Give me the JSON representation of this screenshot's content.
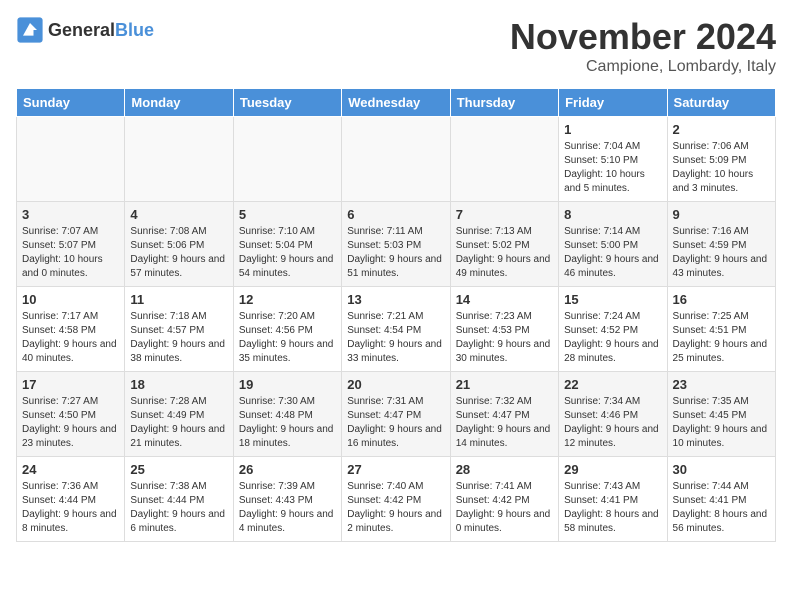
{
  "logo": {
    "general": "General",
    "blue": "Blue"
  },
  "title": "November 2024",
  "location": "Campione, Lombardy, Italy",
  "weekdays": [
    "Sunday",
    "Monday",
    "Tuesday",
    "Wednesday",
    "Thursday",
    "Friday",
    "Saturday"
  ],
  "weeks": [
    [
      {
        "day": "",
        "info": ""
      },
      {
        "day": "",
        "info": ""
      },
      {
        "day": "",
        "info": ""
      },
      {
        "day": "",
        "info": ""
      },
      {
        "day": "",
        "info": ""
      },
      {
        "day": "1",
        "info": "Sunrise: 7:04 AM\nSunset: 5:10 PM\nDaylight: 10 hours and 5 minutes."
      },
      {
        "day": "2",
        "info": "Sunrise: 7:06 AM\nSunset: 5:09 PM\nDaylight: 10 hours and 3 minutes."
      }
    ],
    [
      {
        "day": "3",
        "info": "Sunrise: 7:07 AM\nSunset: 5:07 PM\nDaylight: 10 hours and 0 minutes."
      },
      {
        "day": "4",
        "info": "Sunrise: 7:08 AM\nSunset: 5:06 PM\nDaylight: 9 hours and 57 minutes."
      },
      {
        "day": "5",
        "info": "Sunrise: 7:10 AM\nSunset: 5:04 PM\nDaylight: 9 hours and 54 minutes."
      },
      {
        "day": "6",
        "info": "Sunrise: 7:11 AM\nSunset: 5:03 PM\nDaylight: 9 hours and 51 minutes."
      },
      {
        "day": "7",
        "info": "Sunrise: 7:13 AM\nSunset: 5:02 PM\nDaylight: 9 hours and 49 minutes."
      },
      {
        "day": "8",
        "info": "Sunrise: 7:14 AM\nSunset: 5:00 PM\nDaylight: 9 hours and 46 minutes."
      },
      {
        "day": "9",
        "info": "Sunrise: 7:16 AM\nSunset: 4:59 PM\nDaylight: 9 hours and 43 minutes."
      }
    ],
    [
      {
        "day": "10",
        "info": "Sunrise: 7:17 AM\nSunset: 4:58 PM\nDaylight: 9 hours and 40 minutes."
      },
      {
        "day": "11",
        "info": "Sunrise: 7:18 AM\nSunset: 4:57 PM\nDaylight: 9 hours and 38 minutes."
      },
      {
        "day": "12",
        "info": "Sunrise: 7:20 AM\nSunset: 4:56 PM\nDaylight: 9 hours and 35 minutes."
      },
      {
        "day": "13",
        "info": "Sunrise: 7:21 AM\nSunset: 4:54 PM\nDaylight: 9 hours and 33 minutes."
      },
      {
        "day": "14",
        "info": "Sunrise: 7:23 AM\nSunset: 4:53 PM\nDaylight: 9 hours and 30 minutes."
      },
      {
        "day": "15",
        "info": "Sunrise: 7:24 AM\nSunset: 4:52 PM\nDaylight: 9 hours and 28 minutes."
      },
      {
        "day": "16",
        "info": "Sunrise: 7:25 AM\nSunset: 4:51 PM\nDaylight: 9 hours and 25 minutes."
      }
    ],
    [
      {
        "day": "17",
        "info": "Sunrise: 7:27 AM\nSunset: 4:50 PM\nDaylight: 9 hours and 23 minutes."
      },
      {
        "day": "18",
        "info": "Sunrise: 7:28 AM\nSunset: 4:49 PM\nDaylight: 9 hours and 21 minutes."
      },
      {
        "day": "19",
        "info": "Sunrise: 7:30 AM\nSunset: 4:48 PM\nDaylight: 9 hours and 18 minutes."
      },
      {
        "day": "20",
        "info": "Sunrise: 7:31 AM\nSunset: 4:47 PM\nDaylight: 9 hours and 16 minutes."
      },
      {
        "day": "21",
        "info": "Sunrise: 7:32 AM\nSunset: 4:47 PM\nDaylight: 9 hours and 14 minutes."
      },
      {
        "day": "22",
        "info": "Sunrise: 7:34 AM\nSunset: 4:46 PM\nDaylight: 9 hours and 12 minutes."
      },
      {
        "day": "23",
        "info": "Sunrise: 7:35 AM\nSunset: 4:45 PM\nDaylight: 9 hours and 10 minutes."
      }
    ],
    [
      {
        "day": "24",
        "info": "Sunrise: 7:36 AM\nSunset: 4:44 PM\nDaylight: 9 hours and 8 minutes."
      },
      {
        "day": "25",
        "info": "Sunrise: 7:38 AM\nSunset: 4:44 PM\nDaylight: 9 hours and 6 minutes."
      },
      {
        "day": "26",
        "info": "Sunrise: 7:39 AM\nSunset: 4:43 PM\nDaylight: 9 hours and 4 minutes."
      },
      {
        "day": "27",
        "info": "Sunrise: 7:40 AM\nSunset: 4:42 PM\nDaylight: 9 hours and 2 minutes."
      },
      {
        "day": "28",
        "info": "Sunrise: 7:41 AM\nSunset: 4:42 PM\nDaylight: 9 hours and 0 minutes."
      },
      {
        "day": "29",
        "info": "Sunrise: 7:43 AM\nSunset: 4:41 PM\nDaylight: 8 hours and 58 minutes."
      },
      {
        "day": "30",
        "info": "Sunrise: 7:44 AM\nSunset: 4:41 PM\nDaylight: 8 hours and 56 minutes."
      }
    ]
  ]
}
